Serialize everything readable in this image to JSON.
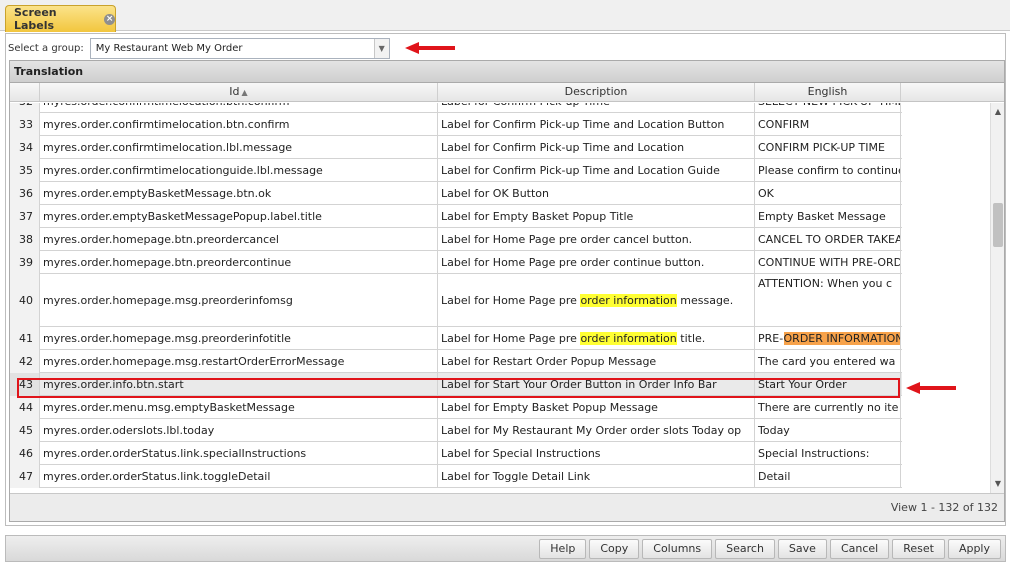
{
  "tab": {
    "title": "Screen Labels"
  },
  "group": {
    "label": "Select a group:",
    "value": "My Restaurant Web My Order"
  },
  "grid": {
    "caption": "Translation",
    "columns": {
      "id": "Id",
      "description": "Description",
      "english": "English"
    },
    "rows": [
      {
        "num": "32",
        "id": "myres.order.confirmtimelocation.btn.confirm",
        "desc": "Label for Confirm Pick-up Time",
        "eng": "SELECT NEW PICK-UP TIME"
      },
      {
        "num": "33",
        "id": "myres.order.confirmtimelocation.btn.confirm",
        "desc": "Label for Confirm Pick-up Time and Location Button",
        "eng": "CONFIRM"
      },
      {
        "num": "34",
        "id": "myres.order.confirmtimelocation.lbl.message",
        "desc": "Label for Confirm Pick-up Time and Location",
        "eng": "CONFIRM PICK-UP TIME"
      },
      {
        "num": "35",
        "id": "myres.order.confirmtimelocationguide.lbl.message",
        "desc": "Label for Confirm Pick-up Time and Location Guide",
        "eng": "Please confirm to continue"
      },
      {
        "num": "36",
        "id": "myres.order.emptyBasketMessage.btn.ok",
        "desc": "Label for OK Button",
        "eng": "OK"
      },
      {
        "num": "37",
        "id": "myres.order.emptyBasketMessagePopup.label.title",
        "desc": "Label for Empty Basket Popup Title",
        "eng": "Empty Basket Message"
      },
      {
        "num": "38",
        "id": "myres.order.homepage.btn.preordercancel",
        "desc": "Label for Home Page pre order cancel button.",
        "eng": "CANCEL TO ORDER TAKEAWAY"
      },
      {
        "num": "39",
        "id": "myres.order.homepage.btn.preordercontinue",
        "desc": "Label for Home Page pre order continue button.",
        "eng": "CONTINUE WITH PRE-ORDER"
      },
      {
        "num": "40",
        "id": "myres.order.homepage.msg.preorderinfomsg",
        "desc_pre": "Label for Home Page pre ",
        "desc_hl": "order information",
        "desc_post": " message.",
        "eng": "ATTENTION: When you c"
      },
      {
        "num": "41",
        "id": "myres.order.homepage.msg.preorderinfotitle",
        "desc_pre": "Label for Home Page pre ",
        "desc_hl": "order information",
        "desc_post": " title.",
        "eng_pre": "PRE-",
        "eng_hl": "ORDER INFORMATION"
      },
      {
        "num": "42",
        "id": "myres.order.homepage.msg.restartOrderErrorMessage",
        "desc": "Label for Restart Order Popup Message",
        "eng": "The card you entered wa"
      },
      {
        "num": "43",
        "id": "myres.order.info.btn.start",
        "desc": "Label for Start Your Order Button in Order Info Bar",
        "eng": "Start Your Order"
      },
      {
        "num": "44",
        "id": "myres.order.menu.msg.emptyBasketMessage",
        "desc": "Label for Empty Basket Popup Message",
        "eng": "There are currently no ite"
      },
      {
        "num": "45",
        "id": "myres.order.oderslots.lbl.today",
        "desc": "Label for My Restaurant My Order order slots Today op",
        "eng": "Today"
      },
      {
        "num": "46",
        "id": "myres.order.orderStatus.link.specialInstructions",
        "desc": "Label for Special Instructions",
        "eng": "Special Instructions:"
      },
      {
        "num": "47",
        "id": "myres.order.orderStatus.link.toggleDetail",
        "desc": "Label for Toggle Detail Link",
        "eng": "Detail"
      }
    ],
    "footer": "View 1 - 132 of 132"
  },
  "toolbar": {
    "help": "Help",
    "copy": "Copy",
    "columns": "Columns",
    "search": "Search",
    "save": "Save",
    "cancel": "Cancel",
    "reset": "Reset",
    "apply": "Apply"
  },
  "colors": {
    "annotation_red": "#e0141a",
    "tab_gold": "#f2c63e",
    "highlight_yellow": "#ffff33",
    "highlight_orange": "#f7a24a"
  }
}
